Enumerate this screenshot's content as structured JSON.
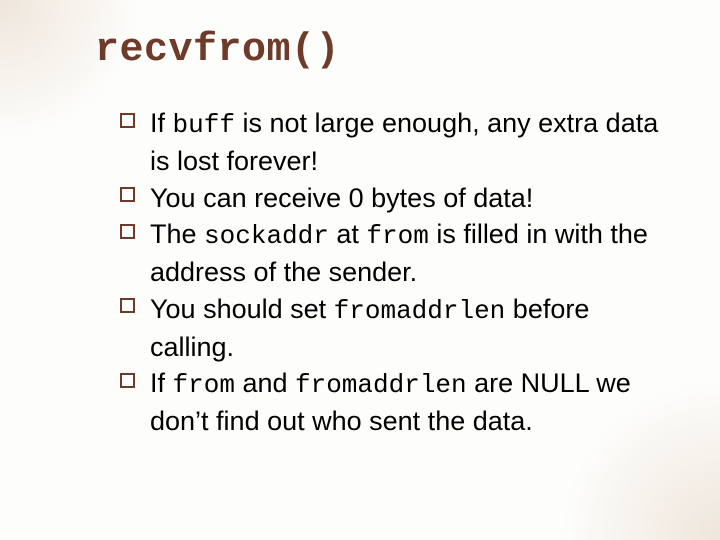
{
  "title": "recvfrom()",
  "bullets": [
    {
      "pre": "If ",
      "code1": "buff",
      "post1": " is not large enough, any extra data is lost forever!"
    },
    {
      "pre": "You can receive 0 bytes of data!"
    },
    {
      "pre": "The ",
      "code1": "sockaddr",
      "mid1": " at ",
      "code2": "from",
      "post1": " is filled in with the address of the sender."
    },
    {
      "pre": "You should set ",
      "code1": "fromaddrlen",
      "post1": " before calling."
    },
    {
      "pre": "If ",
      "code1": "from",
      "mid1": " and ",
      "code2": "fromaddrlen",
      "post1": " are NULL we don’t find out who sent the data."
    }
  ]
}
